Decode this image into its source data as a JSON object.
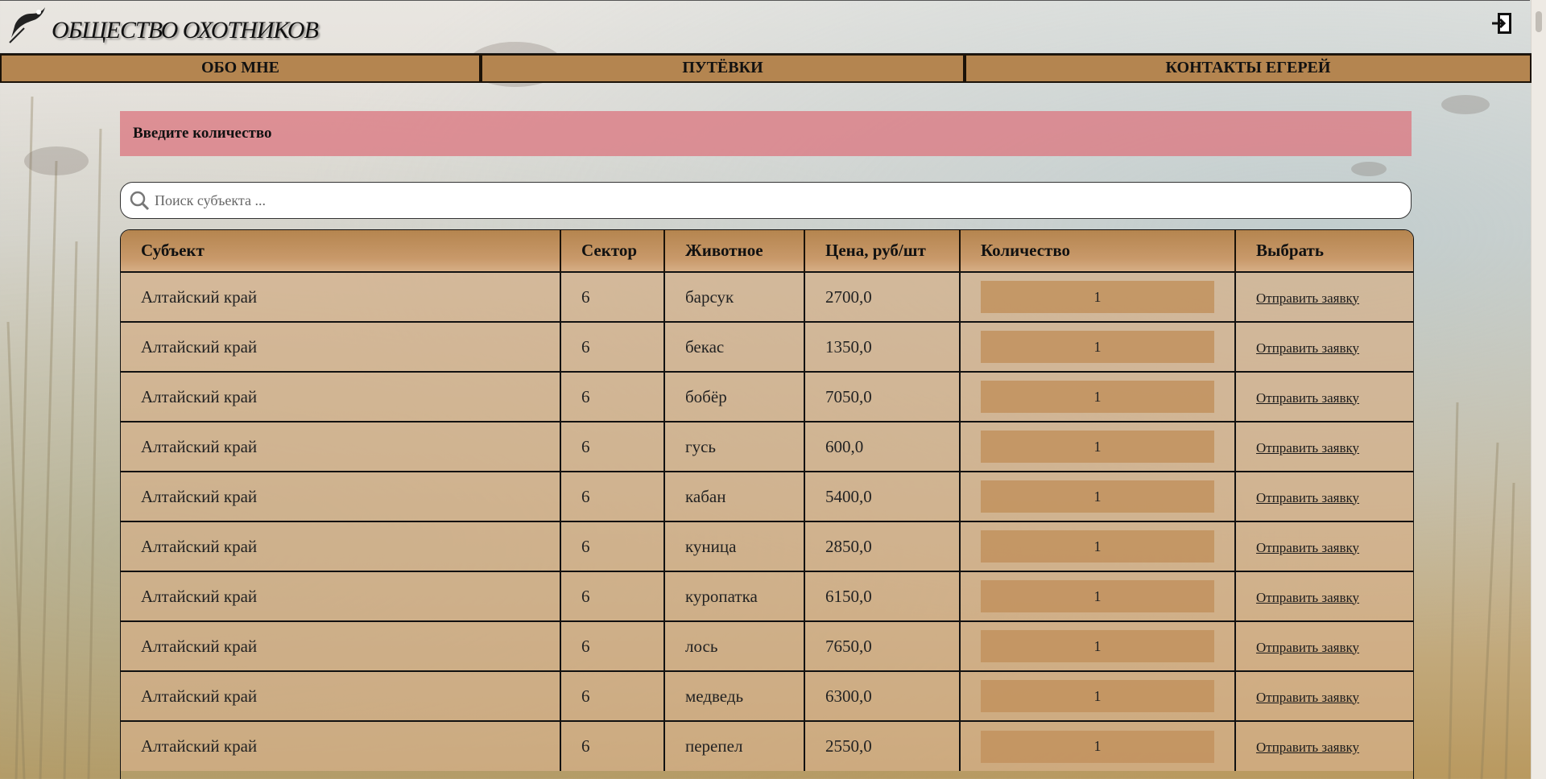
{
  "header": {
    "site_title": "ОБЩЕСТВО ОХОТНИКОВ"
  },
  "icons": {
    "logo": "hunter-duck-logo",
    "logout": "logout-icon",
    "search": "search-icon"
  },
  "nav": {
    "items": [
      {
        "label": "ОБО МНЕ"
      },
      {
        "label": "ПУТЁВКИ"
      },
      {
        "label": "КОНТАКТЫ ЕГЕРЕЙ"
      }
    ]
  },
  "alert": {
    "text": "Введите количество"
  },
  "search": {
    "placeholder": "Поиск субъекта ..."
  },
  "table": {
    "headers": [
      "Субъект",
      "Сектор",
      "Животное",
      "Цена, руб/шт",
      "Количество",
      "Выбрать"
    ],
    "rows": [
      {
        "subject": "Алтайский край",
        "sector": "6",
        "animal": "барсук",
        "price": "2700,0",
        "quantity": "1",
        "action": "Отправить заявку"
      },
      {
        "subject": "Алтайский край",
        "sector": "6",
        "animal": "бекас",
        "price": "1350,0",
        "quantity": "1",
        "action": "Отправить заявку"
      },
      {
        "subject": "Алтайский край",
        "sector": "6",
        "animal": "бобёр",
        "price": "7050,0",
        "quantity": "1",
        "action": "Отправить заявку"
      },
      {
        "subject": "Алтайский край",
        "sector": "6",
        "animal": "гусь",
        "price": "600,0",
        "quantity": "1",
        "action": "Отправить заявку"
      },
      {
        "subject": "Алтайский край",
        "sector": "6",
        "animal": "кабан",
        "price": "5400,0",
        "quantity": "1",
        "action": "Отправить заявку"
      },
      {
        "subject": "Алтайский край",
        "sector": "6",
        "animal": "куница",
        "price": "2850,0",
        "quantity": "1",
        "action": "Отправить заявку"
      },
      {
        "subject": "Алтайский край",
        "sector": "6",
        "animal": "куропатка",
        "price": "6150,0",
        "quantity": "1",
        "action": "Отправить заявку"
      },
      {
        "subject": "Алтайский край",
        "sector": "6",
        "animal": "лось",
        "price": "7650,0",
        "quantity": "1",
        "action": "Отправить заявку"
      },
      {
        "subject": "Алтайский край",
        "sector": "6",
        "animal": "медведь",
        "price": "6300,0",
        "quantity": "1",
        "action": "Отправить заявку"
      },
      {
        "subject": "Алтайский край",
        "sector": "6",
        "animal": "перепел",
        "price": "2550,0",
        "quantity": "1",
        "action": "Отправить заявку"
      }
    ]
  },
  "colors": {
    "nav_bg": "#b48550",
    "alert_bg": "#db7882",
    "table_header": "#b5854f",
    "row_bg": "#d6b089"
  }
}
